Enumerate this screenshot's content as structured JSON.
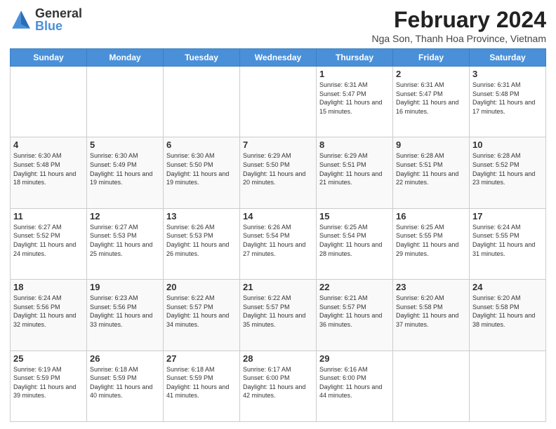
{
  "logo": {
    "general": "General",
    "blue": "Blue"
  },
  "header": {
    "month_year": "February 2024",
    "location": "Nga Son, Thanh Hoa Province, Vietnam"
  },
  "days_of_week": [
    "Sunday",
    "Monday",
    "Tuesday",
    "Wednesday",
    "Thursday",
    "Friday",
    "Saturday"
  ],
  "weeks": [
    [
      {
        "day": "",
        "info": ""
      },
      {
        "day": "",
        "info": ""
      },
      {
        "day": "",
        "info": ""
      },
      {
        "day": "",
        "info": ""
      },
      {
        "day": "1",
        "info": "Sunrise: 6:31 AM\nSunset: 5:47 PM\nDaylight: 11 hours and 15 minutes."
      },
      {
        "day": "2",
        "info": "Sunrise: 6:31 AM\nSunset: 5:47 PM\nDaylight: 11 hours and 16 minutes."
      },
      {
        "day": "3",
        "info": "Sunrise: 6:31 AM\nSunset: 5:48 PM\nDaylight: 11 hours and 17 minutes."
      }
    ],
    [
      {
        "day": "4",
        "info": "Sunrise: 6:30 AM\nSunset: 5:48 PM\nDaylight: 11 hours and 18 minutes."
      },
      {
        "day": "5",
        "info": "Sunrise: 6:30 AM\nSunset: 5:49 PM\nDaylight: 11 hours and 19 minutes."
      },
      {
        "day": "6",
        "info": "Sunrise: 6:30 AM\nSunset: 5:50 PM\nDaylight: 11 hours and 19 minutes."
      },
      {
        "day": "7",
        "info": "Sunrise: 6:29 AM\nSunset: 5:50 PM\nDaylight: 11 hours and 20 minutes."
      },
      {
        "day": "8",
        "info": "Sunrise: 6:29 AM\nSunset: 5:51 PM\nDaylight: 11 hours and 21 minutes."
      },
      {
        "day": "9",
        "info": "Sunrise: 6:28 AM\nSunset: 5:51 PM\nDaylight: 11 hours and 22 minutes."
      },
      {
        "day": "10",
        "info": "Sunrise: 6:28 AM\nSunset: 5:52 PM\nDaylight: 11 hours and 23 minutes."
      }
    ],
    [
      {
        "day": "11",
        "info": "Sunrise: 6:27 AM\nSunset: 5:52 PM\nDaylight: 11 hours and 24 minutes."
      },
      {
        "day": "12",
        "info": "Sunrise: 6:27 AM\nSunset: 5:53 PM\nDaylight: 11 hours and 25 minutes."
      },
      {
        "day": "13",
        "info": "Sunrise: 6:26 AM\nSunset: 5:53 PM\nDaylight: 11 hours and 26 minutes."
      },
      {
        "day": "14",
        "info": "Sunrise: 6:26 AM\nSunset: 5:54 PM\nDaylight: 11 hours and 27 minutes."
      },
      {
        "day": "15",
        "info": "Sunrise: 6:25 AM\nSunset: 5:54 PM\nDaylight: 11 hours and 28 minutes."
      },
      {
        "day": "16",
        "info": "Sunrise: 6:25 AM\nSunset: 5:55 PM\nDaylight: 11 hours and 29 minutes."
      },
      {
        "day": "17",
        "info": "Sunrise: 6:24 AM\nSunset: 5:55 PM\nDaylight: 11 hours and 31 minutes."
      }
    ],
    [
      {
        "day": "18",
        "info": "Sunrise: 6:24 AM\nSunset: 5:56 PM\nDaylight: 11 hours and 32 minutes."
      },
      {
        "day": "19",
        "info": "Sunrise: 6:23 AM\nSunset: 5:56 PM\nDaylight: 11 hours and 33 minutes."
      },
      {
        "day": "20",
        "info": "Sunrise: 6:22 AM\nSunset: 5:57 PM\nDaylight: 11 hours and 34 minutes."
      },
      {
        "day": "21",
        "info": "Sunrise: 6:22 AM\nSunset: 5:57 PM\nDaylight: 11 hours and 35 minutes."
      },
      {
        "day": "22",
        "info": "Sunrise: 6:21 AM\nSunset: 5:57 PM\nDaylight: 11 hours and 36 minutes."
      },
      {
        "day": "23",
        "info": "Sunrise: 6:20 AM\nSunset: 5:58 PM\nDaylight: 11 hours and 37 minutes."
      },
      {
        "day": "24",
        "info": "Sunrise: 6:20 AM\nSunset: 5:58 PM\nDaylight: 11 hours and 38 minutes."
      }
    ],
    [
      {
        "day": "25",
        "info": "Sunrise: 6:19 AM\nSunset: 5:59 PM\nDaylight: 11 hours and 39 minutes."
      },
      {
        "day": "26",
        "info": "Sunrise: 6:18 AM\nSunset: 5:59 PM\nDaylight: 11 hours and 40 minutes."
      },
      {
        "day": "27",
        "info": "Sunrise: 6:18 AM\nSunset: 5:59 PM\nDaylight: 11 hours and 41 minutes."
      },
      {
        "day": "28",
        "info": "Sunrise: 6:17 AM\nSunset: 6:00 PM\nDaylight: 11 hours and 42 minutes."
      },
      {
        "day": "29",
        "info": "Sunrise: 6:16 AM\nSunset: 6:00 PM\nDaylight: 11 hours and 44 minutes."
      },
      {
        "day": "",
        "info": ""
      },
      {
        "day": "",
        "info": ""
      }
    ]
  ]
}
